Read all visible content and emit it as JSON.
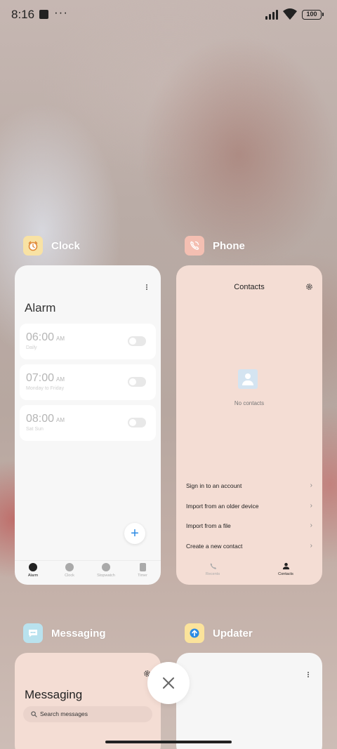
{
  "status_bar": {
    "time": "8:16",
    "battery": "100",
    "more": "···"
  },
  "recents": [
    {
      "app_name": "Clock",
      "icon": "alarm-clock-icon",
      "screen": {
        "title": "Alarm",
        "alarms": [
          {
            "time": "06:00",
            "ampm": "AM",
            "repeat": "Daily",
            "enabled": false
          },
          {
            "time": "07:00",
            "ampm": "AM",
            "repeat": "Monday to Friday",
            "enabled": false
          },
          {
            "time": "08:00",
            "ampm": "AM",
            "repeat": "Sat Sun",
            "enabled": false
          }
        ],
        "fab": "+",
        "tabs": [
          "Alarm",
          "Clock",
          "Stopwatch",
          "Timer"
        ],
        "active_tab": "Alarm"
      }
    },
    {
      "app_name": "Phone",
      "icon": "phone-icon",
      "screen": {
        "title": "Contacts",
        "empty_text": "No contacts",
        "actions": [
          "Sign in to an account",
          "Import from an older device",
          "Import from a file",
          "Create a new contact"
        ],
        "chevron": "›",
        "tabs": [
          "Recents",
          "Contacts"
        ],
        "active_tab": "Contacts"
      }
    },
    {
      "app_name": "Messaging",
      "icon": "message-bubble-icon",
      "screen": {
        "title": "Messaging",
        "search_placeholder": "Search messages"
      }
    },
    {
      "app_name": "Updater",
      "icon": "upload-arrow-icon",
      "screen": {}
    }
  ],
  "colors": {
    "clock_icon_bg": "#f8e2a4",
    "phone_icon_bg": "#f4bfb2",
    "messaging_icon_bg": "#b9e2ee",
    "updater_icon_bg": "#fbe39b",
    "accent_blue": "#2a8ae4"
  }
}
